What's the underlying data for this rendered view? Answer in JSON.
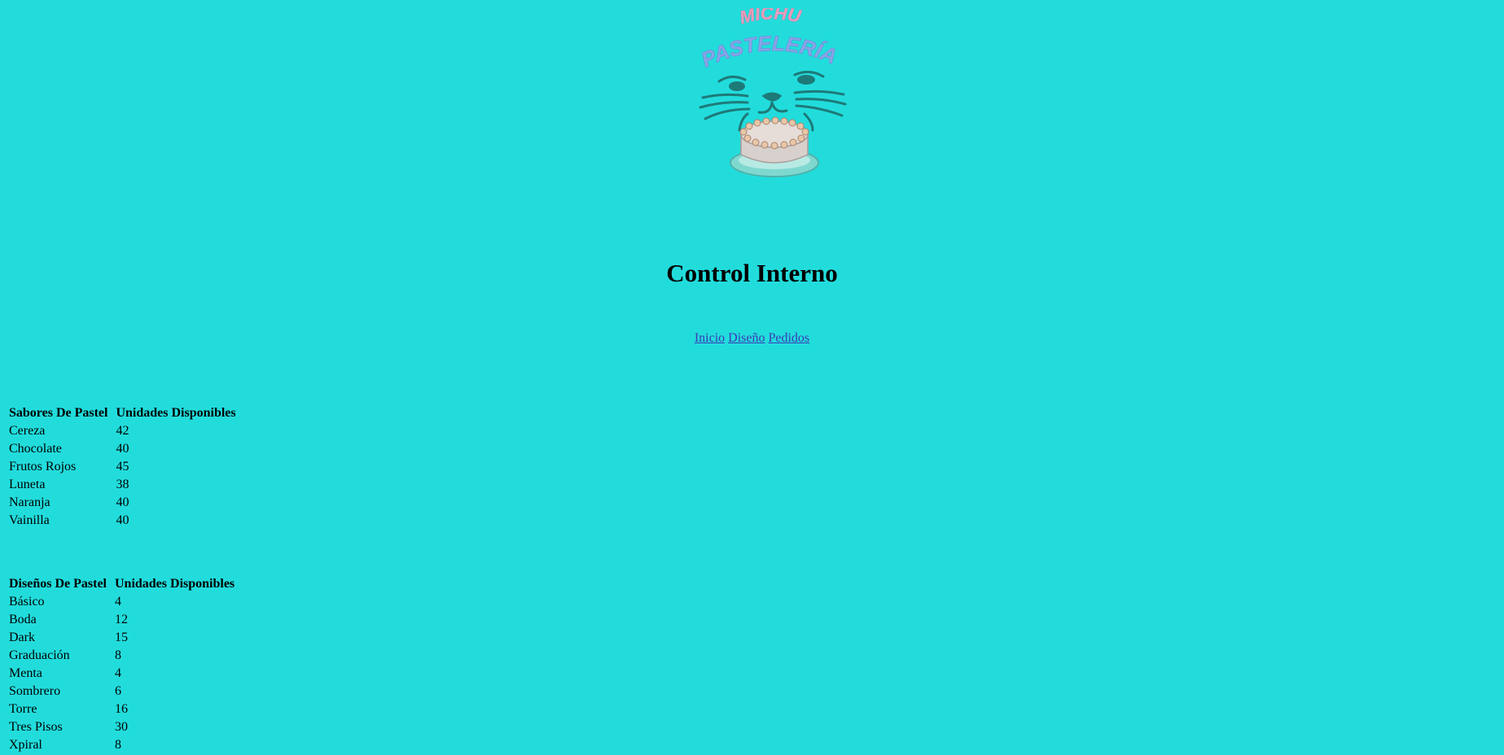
{
  "logo": {
    "line1": "MICHU",
    "line2": "PASTELERÍA",
    "colors": {
      "line1": "#e8a0c0",
      "line2": "#8aa4e8",
      "face": "#1d7a78",
      "cake": "#d8c8c4",
      "plate": "#7fd8d0"
    }
  },
  "title": "Control Interno",
  "nav": [
    {
      "label": "Inicio"
    },
    {
      "label": "Diseño"
    },
    {
      "label": "Pedidos"
    }
  ],
  "sabores": {
    "headers": [
      "Sabores De Pastel",
      "Unidades Disponibles"
    ],
    "rows": [
      {
        "name": "Cereza",
        "units": "42"
      },
      {
        "name": "Chocolate",
        "units": "40"
      },
      {
        "name": "Frutos Rojos",
        "units": "45"
      },
      {
        "name": "Luneta",
        "units": "38"
      },
      {
        "name": "Naranja",
        "units": "40"
      },
      {
        "name": "Vainilla",
        "units": "40"
      }
    ]
  },
  "disenos": {
    "headers": [
      "Diseños De Pastel",
      "Unidades Disponibles"
    ],
    "rows": [
      {
        "name": "Básico",
        "units": "4"
      },
      {
        "name": "Boda",
        "units": "12"
      },
      {
        "name": "Dark",
        "units": "15"
      },
      {
        "name": "Graduación",
        "units": "8"
      },
      {
        "name": "Menta",
        "units": "4"
      },
      {
        "name": "Sombrero",
        "units": "6"
      },
      {
        "name": "Torre",
        "units": "16"
      },
      {
        "name": "Tres Pisos",
        "units": "30"
      },
      {
        "name": "Xpiral",
        "units": "8"
      }
    ]
  },
  "colors": {
    "background": "#22dcdc",
    "link": "#3b3bb5"
  }
}
